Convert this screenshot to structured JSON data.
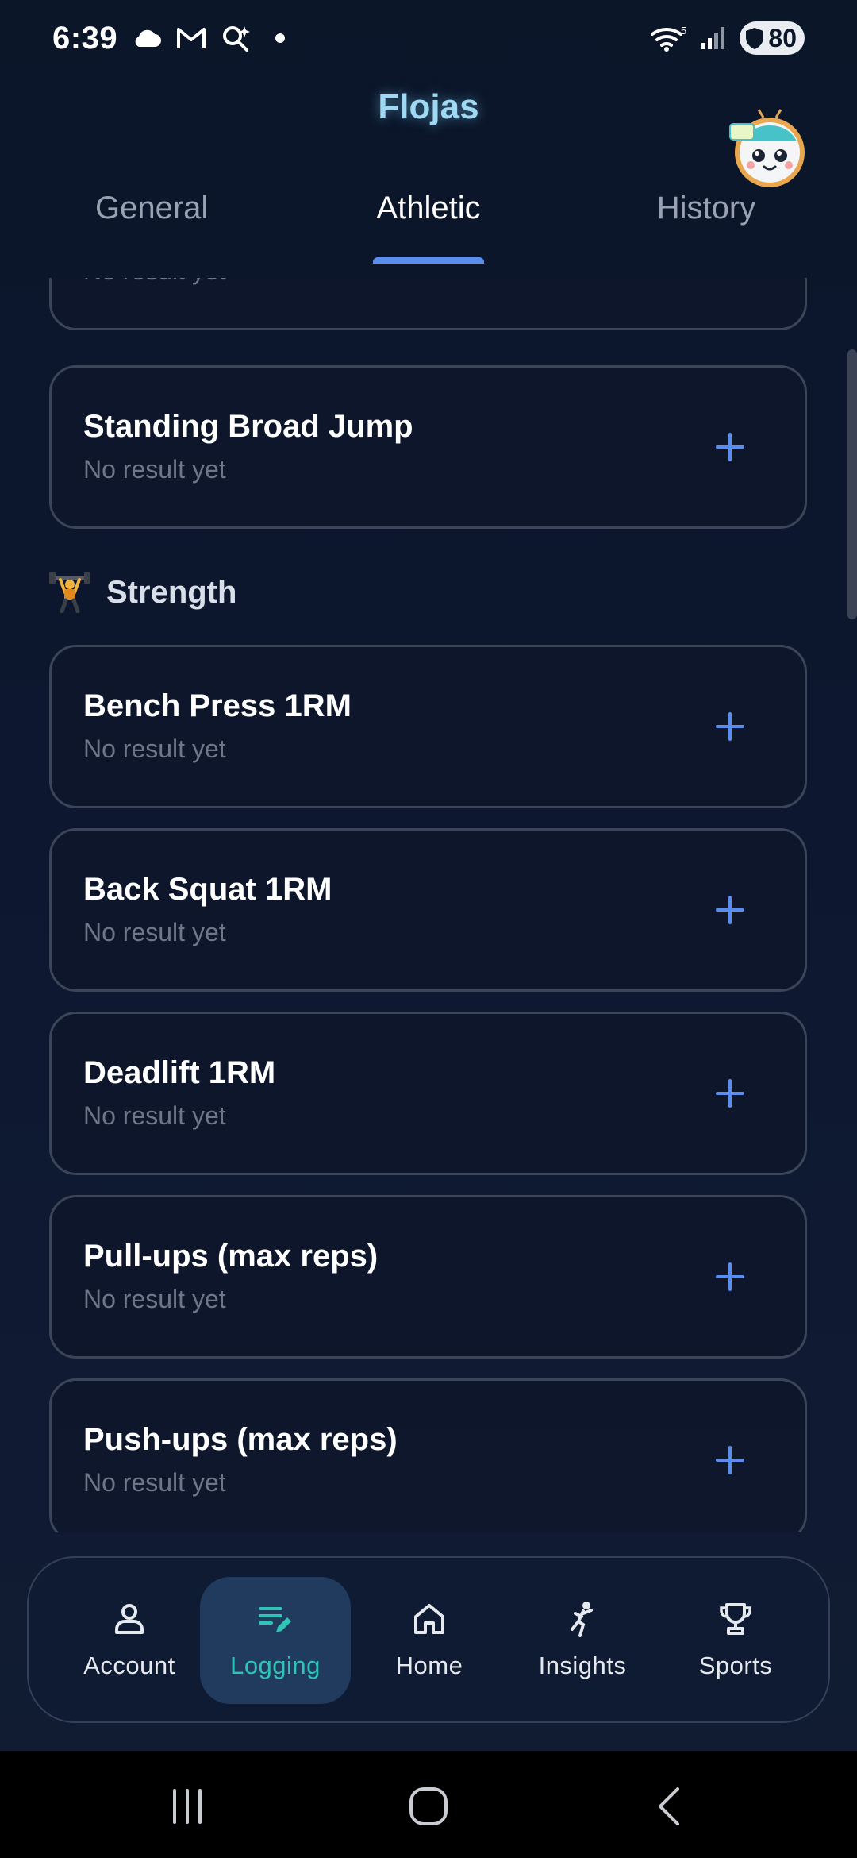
{
  "status_bar": {
    "time": "6:39",
    "battery": "80",
    "icons": [
      "cloud-icon",
      "gmail-icon",
      "assistant-icon",
      "dot-icon",
      "wifi-icon",
      "signal-icon",
      "battery-icon"
    ],
    "wifi_badge": "5"
  },
  "header": {
    "title": "Flojas",
    "title_color": "#9fd8f2"
  },
  "tabs": [
    {
      "label": "General",
      "active": false
    },
    {
      "label": "Athletic",
      "active": true
    },
    {
      "label": "History",
      "active": false
    }
  ],
  "accent_color": "#5b8def",
  "list": {
    "partial_card": {
      "subtitle": "No result yet"
    },
    "jump_cards": [
      {
        "title": "Standing Broad Jump",
        "subtitle": "No result yet"
      }
    ],
    "section": {
      "icon": "weightlifter-icon",
      "title": "Strength"
    },
    "strength_cards": [
      {
        "title": "Bench Press 1RM",
        "subtitle": "No result yet"
      },
      {
        "title": "Back Squat 1RM",
        "subtitle": "No result yet"
      },
      {
        "title": "Deadlift 1RM",
        "subtitle": "No result yet"
      },
      {
        "title": "Pull-ups (max reps)",
        "subtitle": "No result yet"
      },
      {
        "title": "Push-ups (max reps)",
        "subtitle": "No result yet"
      }
    ]
  },
  "bottom_nav": [
    {
      "label": "Account",
      "icon": "person-icon",
      "active": false
    },
    {
      "label": "Logging",
      "icon": "edit-list-icon",
      "active": true
    },
    {
      "label": "Home",
      "icon": "home-icon",
      "active": false
    },
    {
      "label": "Insights",
      "icon": "athlete-icon",
      "active": false
    },
    {
      "label": "Sports",
      "icon": "trophy-icon",
      "active": false
    }
  ],
  "system_nav": [
    "recents-icon",
    "home-circle-icon",
    "back-icon"
  ]
}
